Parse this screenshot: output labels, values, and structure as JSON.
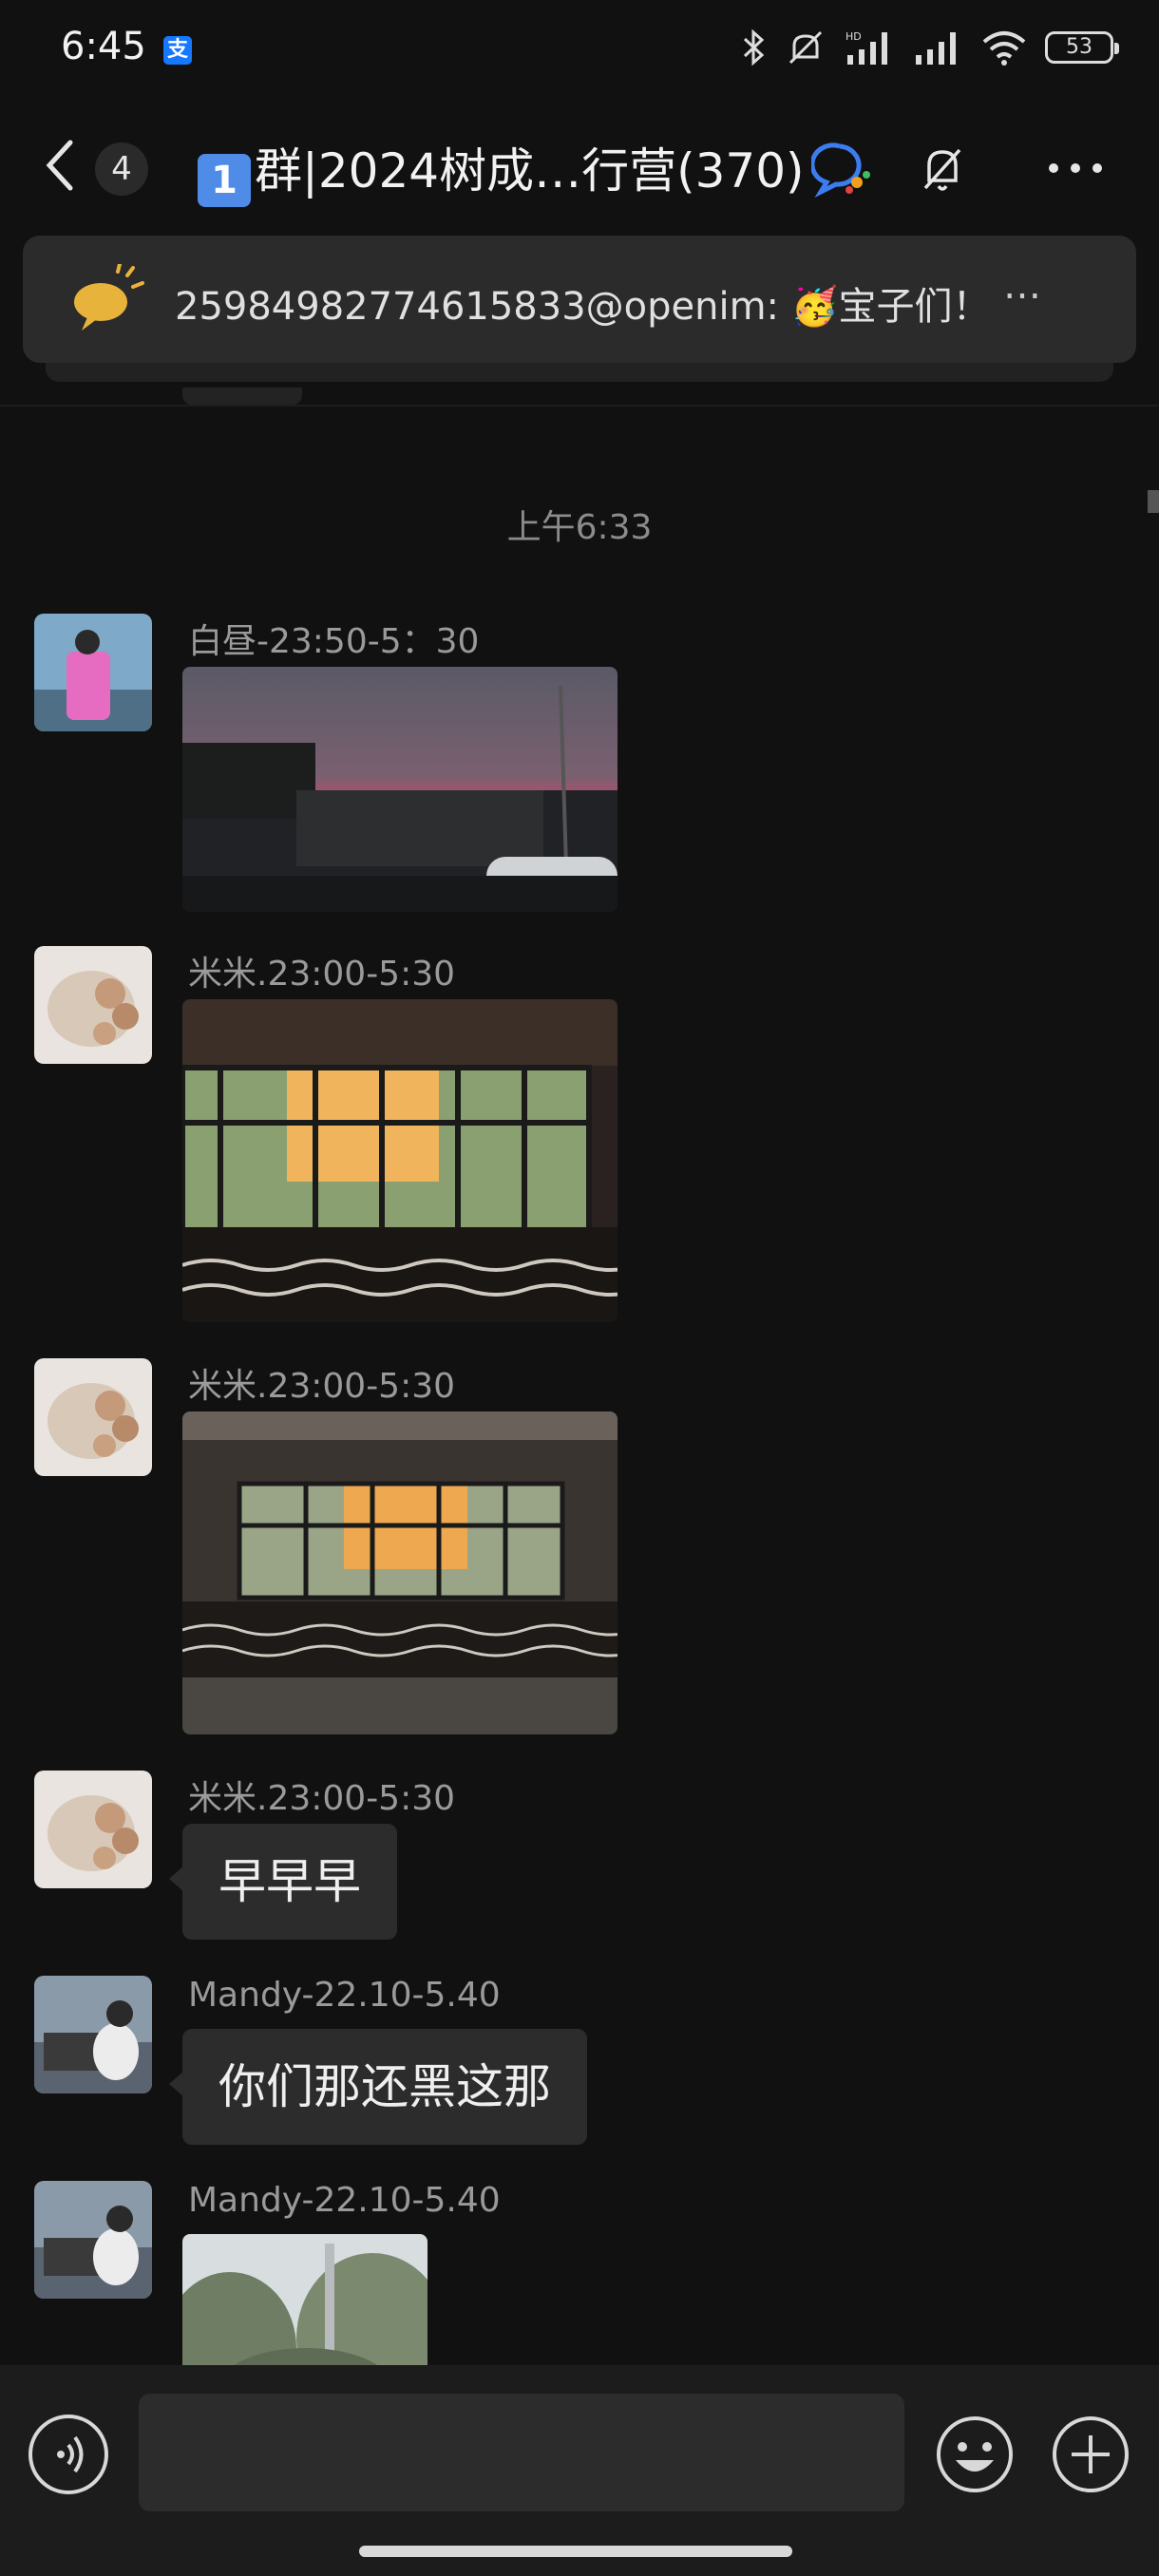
{
  "status_bar": {
    "time": "6:45",
    "app_badge": "支",
    "battery": "53",
    "network_label": "HD"
  },
  "header": {
    "unread_count": "4",
    "title_emoji": "1",
    "title": "群|2024树成…行营(370)"
  },
  "notice": {
    "text": "25984982774615833@openim: 🥳宝子们！",
    "more": "…"
  },
  "chat": {
    "time_divider": "上午6:33",
    "messages": [
      {
        "sender": "白昼-23:50-5：30",
        "type": "image"
      },
      {
        "sender": "米米.23:00-5:30",
        "type": "image"
      },
      {
        "sender": "米米.23:00-5:30",
        "type": "image"
      },
      {
        "sender": "米米.23:00-5:30",
        "type": "text",
        "text": "早早早"
      },
      {
        "sender": "Mandy-22.10-5.40",
        "type": "text",
        "text": "你们那还黑这那"
      },
      {
        "sender": "Mandy-22.10-5.40",
        "type": "image"
      }
    ]
  },
  "icons": {
    "back": "chevron-left-icon",
    "chat_bubble": "chat-bubble-icon",
    "mute": "bell-off-icon",
    "more": "more-horizontal-icon",
    "notice": "megaphone-icon",
    "voice": "voice-icon",
    "emoji": "emoji-icon",
    "plus": "plus-circle-icon"
  },
  "colors": {
    "background": "#111111",
    "bubble": "#2c2c2c",
    "notice_card": "#2b2b2b",
    "input_bar": "#1c1c1c",
    "notice_icon": "#e8b33a"
  }
}
